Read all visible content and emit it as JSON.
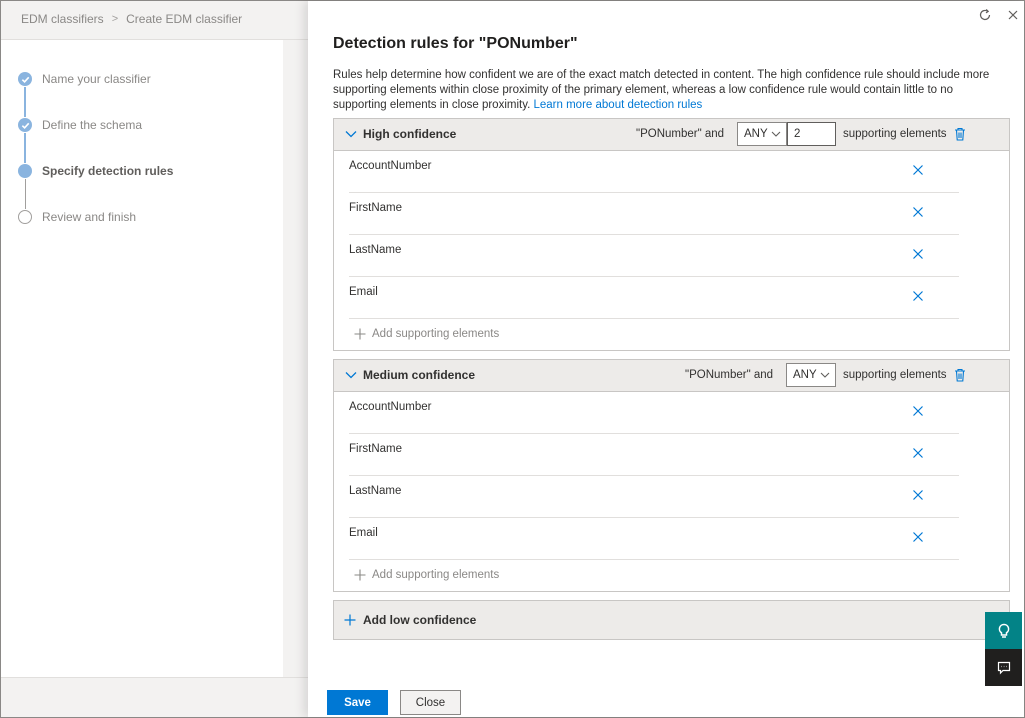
{
  "breadcrumb": {
    "root": "EDM classifiers",
    "separator": ">",
    "current": "Create EDM classifier"
  },
  "wizard": {
    "steps": [
      {
        "label": "Name your classifier",
        "state": "done"
      },
      {
        "label": "Define the schema",
        "state": "done"
      },
      {
        "label": "Specify detection rules",
        "state": "current"
      },
      {
        "label": "Review and finish",
        "state": "pending"
      }
    ]
  },
  "panel": {
    "title": "Detection rules for \"PONumber\"",
    "description": "Rules help determine how confident we are of the exact match detected in content. The high confidence rule should include more supporting elements within close proximity of the primary element, whereas a low confidence rule would contain little to no supporting elements in close proximity.",
    "learn_more": "Learn more about detection rules",
    "refresh_icon": "refresh-icon",
    "close_icon": "close-icon"
  },
  "high": {
    "title": "High confidence",
    "primary": "\"PONumber\" and",
    "match": "ANY",
    "count": "2",
    "supporting_label": "supporting elements",
    "elements": [
      "AccountNumber",
      "FirstName",
      "LastName",
      "Email"
    ],
    "add_label": "Add supporting elements"
  },
  "medium": {
    "title": "Medium confidence",
    "primary": "\"PONumber\" and",
    "match": "ANY",
    "supporting_label": "supporting elements",
    "elements": [
      "AccountNumber",
      "FirstName",
      "LastName",
      "Email"
    ],
    "add_label": "Add supporting elements"
  },
  "add_low_label": "Add low confidence",
  "footer": {
    "save": "Save",
    "close": "Close"
  },
  "colors": {
    "accent": "#0078d4",
    "widget_teal": "#038387",
    "widget_dark": "#201f1e",
    "step_dot": "#8ab4df"
  }
}
